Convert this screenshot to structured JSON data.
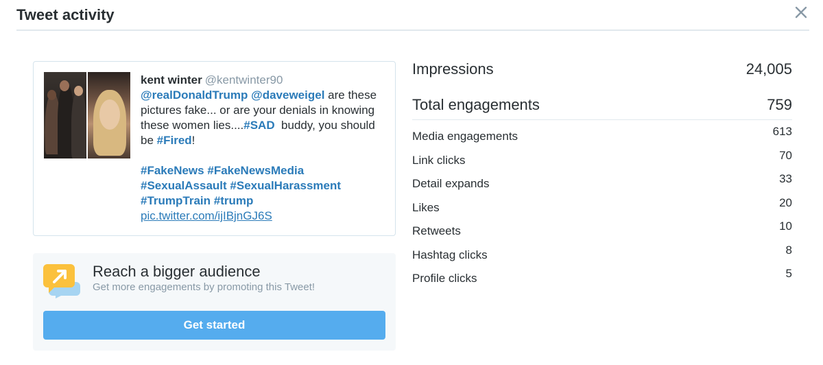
{
  "header": {
    "title": "Tweet activity",
    "close_icon": "close-icon"
  },
  "tweet": {
    "author_name": "kent winter",
    "author_handle": "@kentwinter90",
    "text": {
      "mention1": "@realDonaldTrump",
      "mention2": "@daveweigel",
      "part1": " are these pictures fake... or are your denials in knowing these women lies....",
      "tag_sad": "#SAD",
      "part2": "  buddy, you should be ",
      "tag_fired": "#Fired",
      "part3": "!",
      "tag_fakenews": "#FakeNews",
      "tag_fakenewsmedia": "#FakeNewsMedia",
      "tag_sexualassault": "#SexualAssault",
      "tag_sexualharassment": "#SexualHarassment",
      "tag_trumptrain": "#TrumpTrain",
      "tag_trump": "#trump",
      "link": "pic.twitter.com/ijIBjnGJ6S"
    }
  },
  "promo": {
    "icon": "megaphone-chat-icon",
    "title": "Reach a bigger audience",
    "subtitle": "Get more engagements by promoting this Tweet!",
    "button_label": "Get started"
  },
  "stats": {
    "impressions": {
      "label": "Impressions",
      "value": "24,005"
    },
    "total_engagements": {
      "label": "Total engagements",
      "value": "759"
    },
    "rows": [
      {
        "label": "Media engagements",
        "value": "613"
      },
      {
        "label": "Link clicks",
        "value": "70"
      },
      {
        "label": "Detail expands",
        "value": "33"
      },
      {
        "label": "Likes",
        "value": "20"
      },
      {
        "label": "Retweets",
        "value": "10"
      },
      {
        "label": "Hashtag clicks",
        "value": "8"
      },
      {
        "label": "Profile clicks",
        "value": "5"
      }
    ]
  },
  "colors": {
    "link_blue": "#2b7bb9",
    "button_blue": "#55acee",
    "promo_bg": "#f5f8fa",
    "icon_yellow": "#fbc13d",
    "icon_blue": "#a6d4f2"
  }
}
